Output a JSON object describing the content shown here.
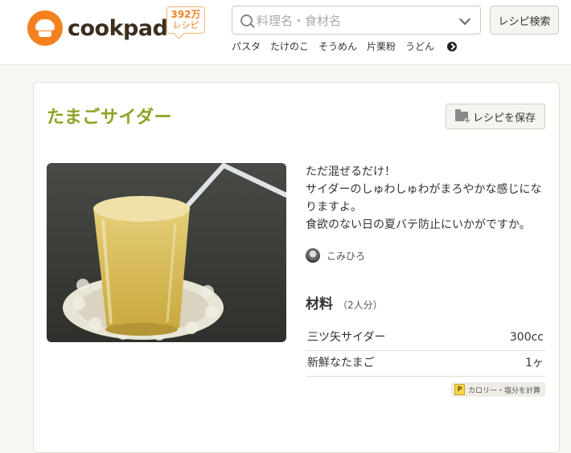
{
  "header": {
    "logo_text": "cookpad",
    "badge": {
      "count": "392万",
      "unit": "レシピ"
    },
    "search": {
      "placeholder": "料理名・食材名"
    },
    "search_button": "レシピ検索",
    "keywords": [
      "パスタ",
      "たけのこ",
      "そうめん",
      "片栗粉",
      "うどん"
    ]
  },
  "recipe": {
    "title": "たまごサイダー",
    "save_button": "レシピを保存",
    "description": [
      "ただ混ぜるだけ！",
      "サイダーのしゅわしゅわがまろやかな感じになりますよ。",
      "食欲のない日の夏バテ防止にいかがですか。"
    ],
    "author": "こみひろ",
    "ingredients_title": "材料",
    "servings": "（2人分）",
    "ingredients": [
      {
        "name": "三ツ矢サイダー",
        "amount": "300cc"
      },
      {
        "name": "新鮮なたまご",
        "amount": "1ヶ"
      }
    ],
    "calorie_link": "カロリー・塩分を計算",
    "calorie_icon": "P"
  },
  "colors": {
    "brand": "#f48120",
    "title": "#8ea325"
  }
}
